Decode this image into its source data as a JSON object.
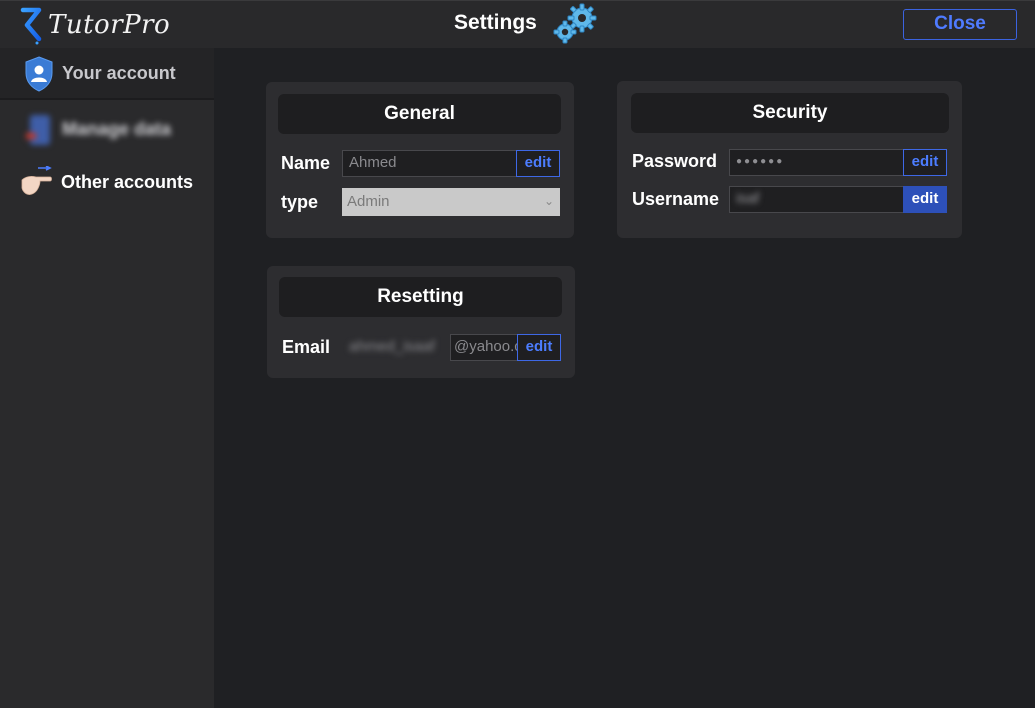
{
  "app": {
    "name": "TutorPro",
    "title": "Settings",
    "close_label": "Close"
  },
  "sidebar": {
    "items": [
      {
        "label": "Your account",
        "icon": "shield-user-icon",
        "active": true
      },
      {
        "label": "Manage data",
        "icon": "data-icon",
        "blurred": true
      },
      {
        "label": "Other accounts",
        "icon": "hand-switch-icon"
      }
    ]
  },
  "general": {
    "title": "General",
    "name_label": "Name",
    "name_placeholder": "Ahmed",
    "edit_label": "edit",
    "type_label": "type",
    "type_value": "Admin"
  },
  "security": {
    "title": "Security",
    "password_label": "Password",
    "password_mask": "●●●●●●",
    "username_label": "Username",
    "username_value": "isaf",
    "edit_label": "edit"
  },
  "resetting": {
    "title": "Resetting",
    "email_label": "Email",
    "email_user": "ahmed_isaaf",
    "email_domain": "@yahoo.com",
    "edit_label": "edit"
  },
  "colors": {
    "accent": "#3b63e0",
    "background": "#1f2023",
    "panel": "#2d2d30"
  }
}
